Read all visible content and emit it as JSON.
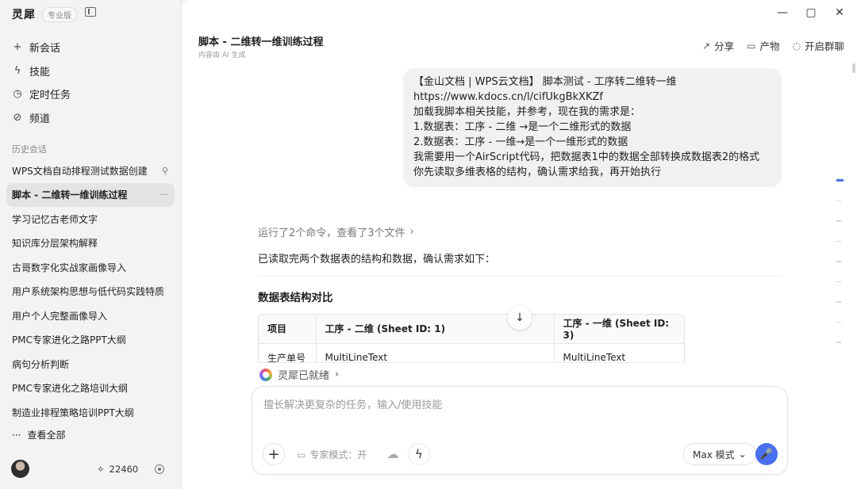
{
  "app": {
    "name": "灵犀",
    "edition_badge": "专业版"
  },
  "nav": [
    {
      "label": "新会话",
      "icon": "+"
    },
    {
      "label": "技能",
      "icon": "ϟ"
    },
    {
      "label": "定时任务",
      "icon": "◷"
    },
    {
      "label": "频道",
      "icon": "⊘"
    }
  ],
  "history": {
    "label": "历史会话",
    "items": [
      {
        "label": "WPS文档自动排程测试数据创建",
        "trail": "⚲"
      },
      {
        "label": "脚本 - 二维转一维训练过程",
        "trail": "···"
      },
      {
        "label": "学习记忆古老师文字"
      },
      {
        "label": "知识库分层架构解释"
      },
      {
        "label": "古哥数字化实战家画像导入"
      },
      {
        "label": "用户系统架构思想与低代码实践特质"
      },
      {
        "label": "用户个人完整画像导入"
      },
      {
        "label": "PMC专家进化之路PPT大纲"
      },
      {
        "label": "病句分析判断"
      },
      {
        "label": "PMC专家进化之路培训大纲"
      },
      {
        "label": "制造业排程策略培训PPT大纲"
      }
    ],
    "see_all": "查看全部"
  },
  "footer": {
    "credits": "22460"
  },
  "conversation": {
    "title": "脚本 - 二维转一维训练过程",
    "subtitle": "内容由 AI 生成",
    "actions": [
      {
        "label": "分享",
        "icon": "↗"
      },
      {
        "label": "产物",
        "icon": "▭"
      },
      {
        "label": "开启群聊",
        "icon": "◌"
      }
    ],
    "user_message": [
      "【金山文档 | WPS云文档】 脚本测试 - 工序转二维转一维",
      " https://www.kdocs.cn/l/cifUkgBkXKZf",
      "加载我脚本相关技能，并参考，现在我的需求是：",
      "1.数据表：工序 - 二维 →是一个二维形式的数据",
      "2.数据表：工序 - 一维→是一个一维形式的数据",
      "我需要用一个AirScript代码，把数据表1中的数据全部转换成数据表2的格式",
      "你先读取多维表格的结构，确认需求给我，再开始执行"
    ],
    "run_summary": "运行了2个命令，查看了3个文件",
    "answer_intro": "已读取完两个数据表的结构和数据，确认需求如下：",
    "section_heading": "数据表结构对比",
    "table": {
      "headers": [
        "项目",
        "工序 - 二维 (Sheet ID: 1)",
        "工序 - 一维 (Sheet ID: 3)"
      ],
      "rows": [
        [
          "生产单号",
          "MultiLineText",
          "MultiLineText"
        ]
      ]
    },
    "agent_status": "灵犀已就绪"
  },
  "composer": {
    "placeholder": "擅长解决更复杂的任务，输入/使用技能",
    "expert_mode": "专家模式：开",
    "model": "Max 模式"
  },
  "progress": {
    "total_markers": 9,
    "active_index": 0
  }
}
